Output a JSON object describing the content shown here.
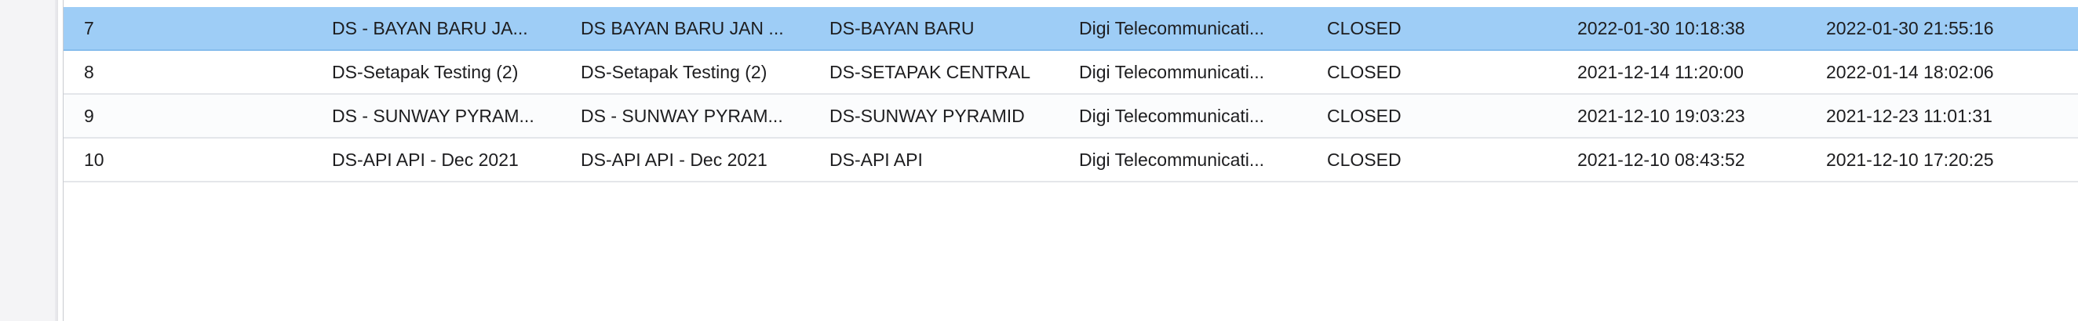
{
  "table": {
    "rows": [
      {
        "no": "7",
        "name": "DS - BAYAN BARU JA...",
        "description": "DS BAYAN BARU JAN ...",
        "site": "DS-BAYAN BARU",
        "company": "Digi Telecommunicati...",
        "status": "CLOSED",
        "start": "2022-01-30 10:18:38",
        "end": "2022-01-30 21:55:16",
        "selected": true
      },
      {
        "no": "8",
        "name": "DS-Setapak Testing (2)",
        "description": "DS-Setapak Testing (2)",
        "site": "DS-SETAPAK CENTRAL",
        "company": "Digi Telecommunicati...",
        "status": "CLOSED",
        "start": "2021-12-14 11:20:00",
        "end": "2022-01-14 18:02:06",
        "selected": false
      },
      {
        "no": "9",
        "name": "DS - SUNWAY PYRAM...",
        "description": "DS - SUNWAY PYRAM...",
        "site": "DS-SUNWAY PYRAMID",
        "company": "Digi Telecommunicati...",
        "status": "CLOSED",
        "start": "2021-12-10 19:03:23",
        "end": "2021-12-23 11:01:31",
        "selected": false
      },
      {
        "no": "10",
        "name": "DS-API API - Dec 2021",
        "description": "DS-API API - Dec 2021",
        "site": "DS-API API",
        "company": "Digi Telecommunicati...",
        "status": "CLOSED",
        "start": "2021-12-10 08:43:52",
        "end": "2021-12-10 17:20:25",
        "selected": false
      }
    ]
  },
  "colors": {
    "selected_row": "#9ecdf6",
    "row_border": "#e4e6ea",
    "text": "#1d1d1f"
  }
}
